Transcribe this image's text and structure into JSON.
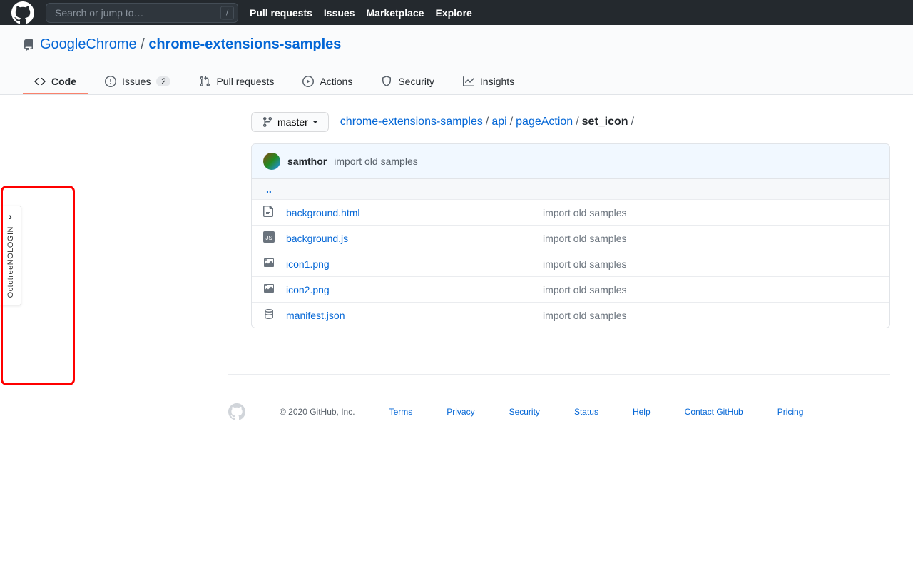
{
  "topbar": {
    "search_placeholder": "Search or jump to…",
    "slash": "/",
    "nav": [
      "Pull requests",
      "Issues",
      "Marketplace",
      "Explore"
    ]
  },
  "repo": {
    "owner": "GoogleChrome",
    "name": "chrome-extensions-samples"
  },
  "tabs": {
    "code": "Code",
    "issues": "Issues",
    "issues_count": "2",
    "pulls": "Pull requests",
    "actions": "Actions",
    "security": "Security",
    "insights": "Insights"
  },
  "branch": "master",
  "breadcrumb": {
    "root": "chrome-extensions-samples",
    "p1": "api",
    "p2": "pageAction",
    "current": "set_icon"
  },
  "commit": {
    "author": "samthor",
    "message": "import old samples"
  },
  "updir": "..",
  "files": [
    {
      "name": "background.html",
      "msg": "import old samples",
      "type": "html"
    },
    {
      "name": "background.js",
      "msg": "import old samples",
      "type": "js"
    },
    {
      "name": "icon1.png",
      "msg": "import old samples",
      "type": "img"
    },
    {
      "name": "icon2.png",
      "msg": "import old samples",
      "type": "img"
    },
    {
      "name": "manifest.json",
      "msg": "import old samples",
      "type": "data"
    }
  ],
  "octotree": "OctotreeNOLOGIN",
  "footer": {
    "copyright": "© 2020 GitHub, Inc.",
    "links": [
      "Terms",
      "Privacy",
      "Security",
      "Status",
      "Help",
      "Contact GitHub",
      "Pricing"
    ]
  }
}
